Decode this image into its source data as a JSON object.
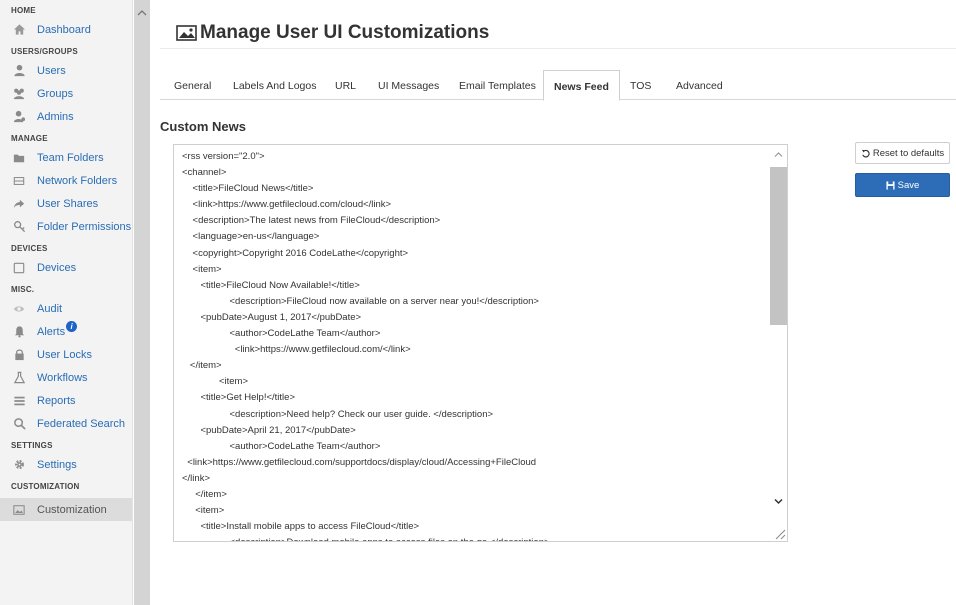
{
  "sidebar": {
    "sections": [
      {
        "label": "HOME",
        "items": [
          {
            "label": "Dashboard",
            "icon": "home-icon"
          }
        ]
      },
      {
        "label": "USERS/GROUPS",
        "items": [
          {
            "label": "Users",
            "icon": "user-icon"
          },
          {
            "label": "Groups",
            "icon": "group-icon"
          },
          {
            "label": "Admins",
            "icon": "admin-icon"
          }
        ]
      },
      {
        "label": "MANAGE",
        "items": [
          {
            "label": "Team Folders",
            "icon": "folder-icon"
          },
          {
            "label": "Network Folders",
            "icon": "network-folder-icon"
          },
          {
            "label": "User Shares",
            "icon": "share-icon"
          },
          {
            "label": "Folder Permissions",
            "icon": "permissions-icon"
          }
        ]
      },
      {
        "label": "DEVICES",
        "items": [
          {
            "label": "Devices",
            "icon": "device-icon"
          }
        ]
      },
      {
        "label": "MISC.",
        "items": [
          {
            "label": "Audit",
            "icon": "eye-icon"
          },
          {
            "label": "Alerts",
            "icon": "bell-icon",
            "badge": "i"
          },
          {
            "label": "User Locks",
            "icon": "lock-icon"
          },
          {
            "label": "Workflows",
            "icon": "flask-icon"
          },
          {
            "label": "Reports",
            "icon": "list-icon"
          },
          {
            "label": "Federated Search",
            "icon": "search-icon"
          }
        ]
      },
      {
        "label": "SETTINGS",
        "items": [
          {
            "label": "Settings",
            "icon": "gear-icon"
          }
        ]
      },
      {
        "label": "CUSTOMIZATION",
        "items": [
          {
            "label": "Customization",
            "icon": "image-icon",
            "active": true
          }
        ]
      }
    ]
  },
  "header": {
    "title": "Manage User UI Customizations"
  },
  "tabs": [
    {
      "label": "General"
    },
    {
      "label": "Labels And Logos"
    },
    {
      "label": "URL"
    },
    {
      "label": "UI Messages"
    },
    {
      "label": "Email Templates"
    },
    {
      "label": "News Feed",
      "active": true
    },
    {
      "label": "TOS"
    },
    {
      "label": "Advanced"
    }
  ],
  "section_title": "Custom News",
  "editor": {
    "value": "<rss version=\"2.0\">\n<channel>\n    <title>FileCloud News</title>\n    <link>https://www.getfilecloud.com/cloud</link>\n    <description>The latest news from FileCloud</description>\n    <language>en-us</language>\n    <copyright>Copyright 2016 CodeLathe</copyright>\n    <item>\n       <title>FileCloud Now Available!</title>\n                  <description>FileCloud now available on a server near you!</description>\n       <pubDate>August 1, 2017</pubDate>\n                  <author>CodeLathe Team</author>\n                    <link>https://www.getfilecloud.com/</link>\n   </item>\n              <item>\n       <title>Get Help!</title>\n                  <description>Need help? Check our user guide. </description>\n       <pubDate>April 21, 2017</pubDate>\n                  <author>CodeLathe Team</author>\n  <link>https://www.getfilecloud.com/supportdocs/display/cloud/Accessing+FileCloud\n</link>\n     </item>\n     <item>\n       <title>Install mobile apps to access FileCloud</title>\n                  <description>Download mobile apps to access files on the go.</description>"
  },
  "buttons": {
    "reset": "Reset to defaults",
    "save": "Save"
  },
  "colors": {
    "accent": "#2d6db8",
    "link": "#2a6db5",
    "sidebar_bg": "#f3f3f3"
  }
}
